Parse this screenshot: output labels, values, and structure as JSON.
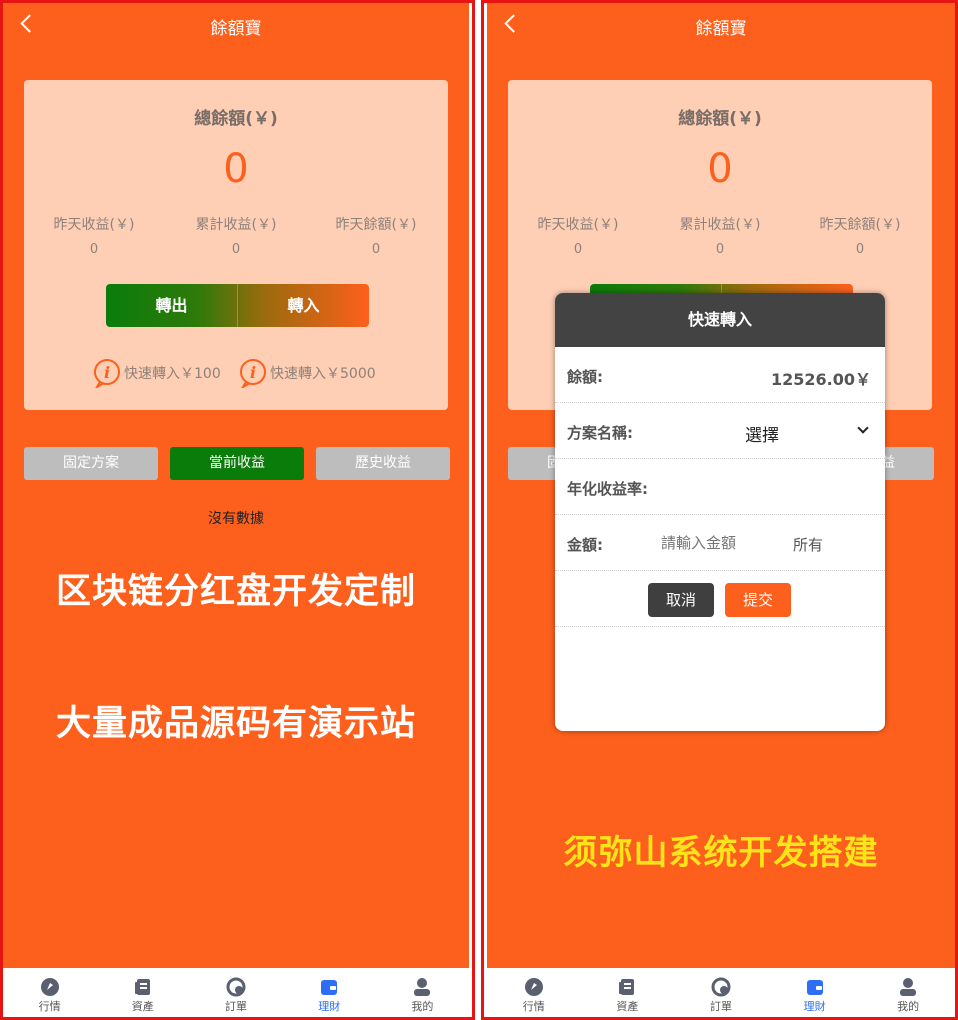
{
  "colors": {
    "accent": "#fd601c",
    "green": "#0a7c0a",
    "nav_active": "#2d6ef5",
    "promo_yellow": "#fde31a"
  },
  "header": {
    "title": "餘額寶"
  },
  "balance": {
    "title": "總餘額(￥)",
    "amount": "0",
    "stats": [
      {
        "label": "昨天收益(￥)",
        "value": "0"
      },
      {
        "label": "累計收益(￥)",
        "value": "0"
      },
      {
        "label": "昨天餘額(￥)",
        "value": "0"
      }
    ],
    "transfer_out": "轉出",
    "transfer_in": "轉入",
    "quick": [
      {
        "label": "快速轉入￥100"
      },
      {
        "label": "快速轉入￥5000"
      }
    ]
  },
  "tabs": [
    {
      "label": "固定方案",
      "active": false
    },
    {
      "label": "當前收益",
      "active": true
    },
    {
      "label": "歷史收益",
      "active": false
    }
  ],
  "empty_text": "沒有數據",
  "promo": {
    "line1": "区块链分红盘开发定制",
    "line2": "大量成品源码有演示站",
    "line3": "须弥山系统开发搭建"
  },
  "modal": {
    "title": "快速轉入",
    "balance_label": "餘額:",
    "balance_value": "12526.00￥",
    "plan_label": "方案名稱:",
    "plan_select": "選擇",
    "rate_label": "年化收益率:",
    "amount_label": "金額:",
    "amount_placeholder": "請輸入金額",
    "all_label": "所有",
    "cancel": "取消",
    "submit": "提交"
  },
  "nav": [
    {
      "label": "行情",
      "icon": "market-icon",
      "active": false
    },
    {
      "label": "資產",
      "icon": "assets-icon",
      "active": false
    },
    {
      "label": "訂單",
      "icon": "orders-icon",
      "active": false
    },
    {
      "label": "理財",
      "icon": "wallet-icon",
      "active": true
    },
    {
      "label": "我的",
      "icon": "user-icon",
      "active": false
    }
  ]
}
